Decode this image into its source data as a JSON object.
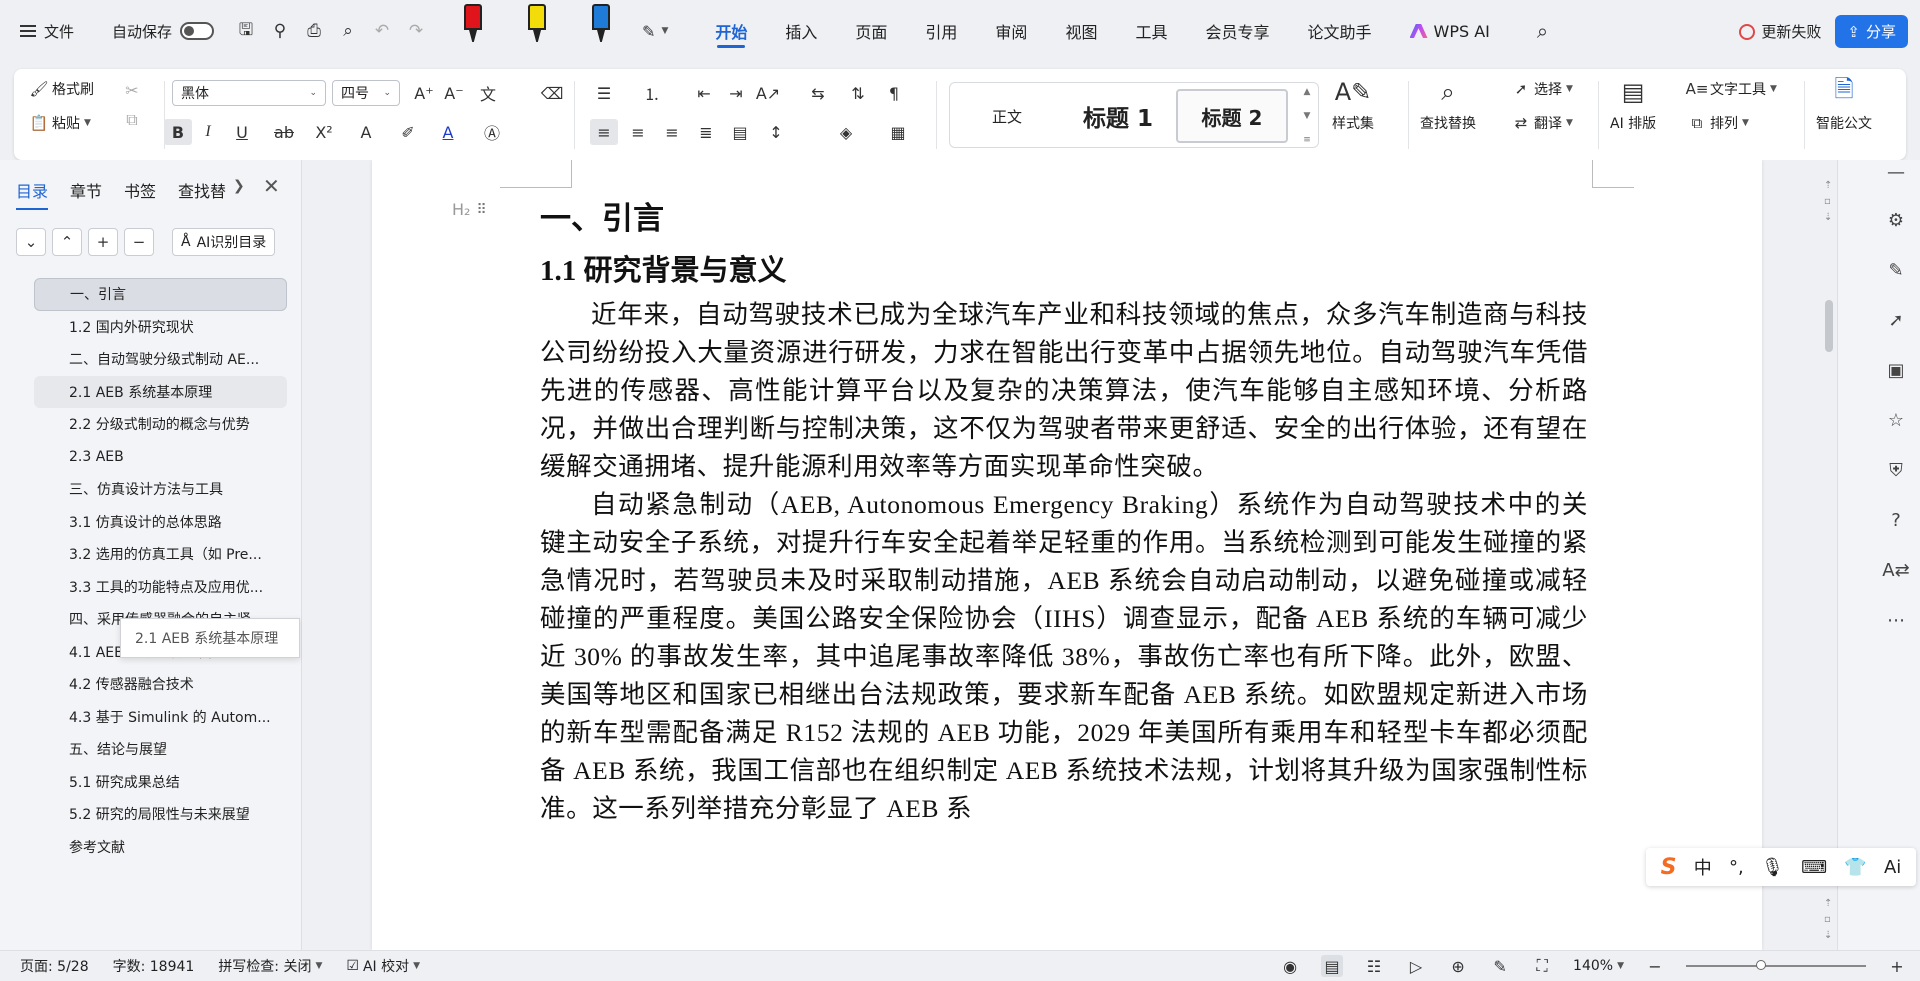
{
  "menubar": {
    "file_label": "文件",
    "autosave_label": "自动保存",
    "tabs": [
      {
        "label": "开始",
        "active": true
      },
      {
        "label": "插入"
      },
      {
        "label": "页面"
      },
      {
        "label": "引用"
      },
      {
        "label": "审阅"
      },
      {
        "label": "视图"
      },
      {
        "label": "工具"
      },
      {
        "label": "会员专享"
      },
      {
        "label": "论文助手"
      },
      {
        "label": "WPS AI"
      }
    ],
    "sync_label": "更新失败",
    "share_label": "分享",
    "marker_colors": [
      "#e0151b",
      "#f2dd0a",
      "#1e7bd8"
    ]
  },
  "ribbon": {
    "format_painter": "格式刷",
    "paste": "粘贴",
    "font_name": "黑体",
    "font_size": "四号",
    "styles": {
      "normal": "正文",
      "heading1": "标题 1",
      "heading2": "标题 2",
      "style_set": "样式集"
    },
    "find_replace": "查找替换",
    "select": "选择",
    "translate": "翻译",
    "ai_layout": "AI 排版",
    "text_tools": "文字工具",
    "arrange": "排列",
    "smart_doc": "智能公文"
  },
  "nav": {
    "tabs": [
      "目录",
      "章节",
      "书签",
      "查找替"
    ],
    "ai_toc": "AI识别目录",
    "toc": [
      "一、引言",
      "1.1 研究背景与意义",
      "1.2 国内外研究现状",
      "二、自动驾驶分级式制动 AE...",
      "2.1 AEB 系统基本原理",
      "2.2 分级式制动的概念与优势",
      "2.3 AEB",
      "三、仿真设计方法与工具",
      "3.1 仿真设计的总体思路",
      "3.2 选用的仿真工具（如 Pre...",
      "3.3 工具的功能特点及应用优...",
      "四、采用传感器融合的自主紧...",
      "4.1 AEB 系统的传感器原理",
      "4.2 传感器融合技术",
      "4.3 基于 Simulink 的 Autom...",
      "五、结论与展望",
      "5.1 研究成果总结",
      "5.2 研究的局限性与未来展望",
      "参考文献"
    ],
    "tooltip": "2.1 AEB 系统基本原理"
  },
  "document": {
    "heading_marker": "H₂",
    "h1": "一、引言",
    "h2": "1.1 研究背景与意义",
    "p1": "近年来，自动驾驶技术已成为全球汽车产业和科技领域的焦点，众多汽车制造商与科技公司纷纷投入大量资源进行研发，力求在智能出行变革中占据领先地位。自动驾驶汽车凭借先进的传感器、高性能计算平台以及复杂的决策算法，使汽车能够自主感知环境、分析路况，并做出合理判断与控制决策，这不仅为驾驶者带来更舒适、安全的出行体验，还有望在缓解交通拥堵、提升能源利用效率等方面实现革命性突破。",
    "p2": "自动紧急制动（AEB, Autonomous Emergency Braking）系统作为自动驾驶技术中的关键主动安全子系统，对提升行车安全起着举足轻重的作用。当系统检测到可能发生碰撞的紧急情况时，若驾驶员未及时采取制动措施，AEB 系统会自动启动制动，以避免碰撞或减轻碰撞的严重程度。美国公路安全保险协会（IIHS）调查显示，配备 AEB 系统的车辆可减少近 30% 的事故发生率，其中追尾事故率降低 38%，事故伤亡率也有所下降。此外，欧盟、美国等地区和国家已相继出台法规政策，要求新车配备 AEB 系统。如欧盟规定新进入市场的新车型需配备满足 R152 法规的 AEB 功能，2029 年美国所有乘用车和轻型卡车都必须配备 AEB 系统，我国工信部也在组织制定 AEB 系统技术法规，计划将其升级为国家强制性标准。这一系列举措充分彰显了 AEB 系"
  },
  "statusbar": {
    "page": "页面: 5/28",
    "words": "字数: 18941",
    "spellcheck": "拼写检查: 关闭",
    "ai_proofread": "AI 校对",
    "zoom": "140%"
  },
  "ime": {
    "mode": "中"
  }
}
